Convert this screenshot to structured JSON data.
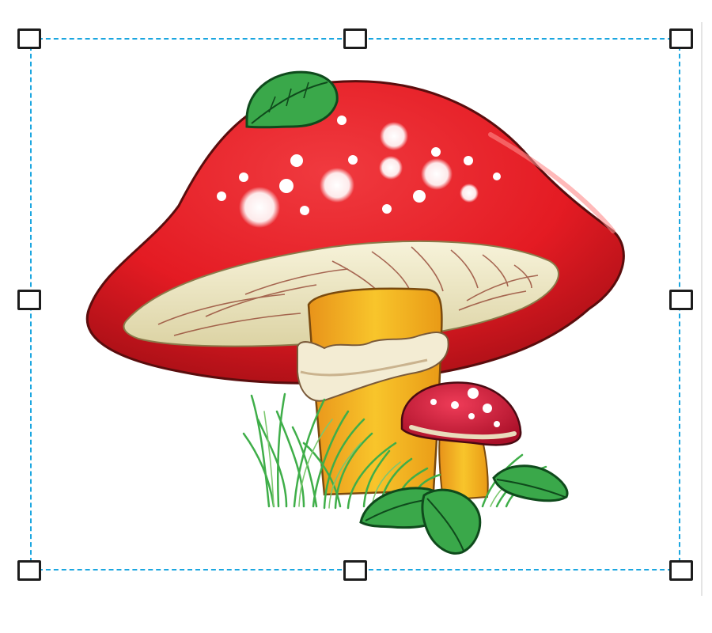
{
  "canvas": {
    "selected_object": "mushroom-clipart",
    "colors": {
      "selection_border": "#1aa6e0",
      "handle_border": "#1c1c1c",
      "handle_fill": "#ffffff",
      "cap_red": "#e41b23",
      "cap_dark_red": "#a80f16",
      "gills": "#f2eecb",
      "stem": "#f6b31c",
      "grass": "#3fae49",
      "leaf": "#2f9a45",
      "small_cap": "#d3193a"
    }
  },
  "handles": [
    {
      "id": "top-left",
      "icon": "resize-handle"
    },
    {
      "id": "top-center",
      "icon": "resize-handle"
    },
    {
      "id": "top-right",
      "icon": "resize-handle"
    },
    {
      "id": "middle-left",
      "icon": "resize-handle"
    },
    {
      "id": "middle-right",
      "icon": "resize-handle"
    },
    {
      "id": "bottom-left",
      "icon": "resize-handle"
    },
    {
      "id": "bottom-center",
      "icon": "resize-handle"
    },
    {
      "id": "bottom-right",
      "icon": "resize-handle"
    }
  ]
}
